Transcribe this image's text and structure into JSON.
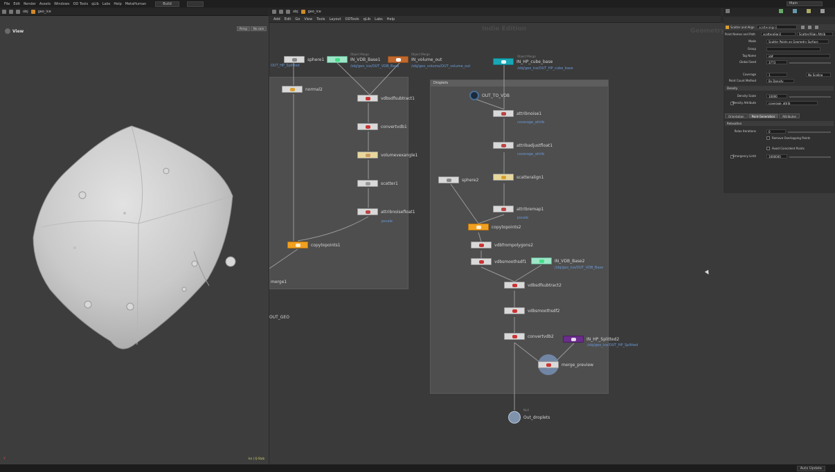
{
  "menubar": {
    "items": [
      "File",
      "Edit",
      "Render",
      "Assets",
      "Windows",
      "OD Tools",
      "qLib",
      "Labs",
      "Help",
      "MetaHuman"
    ],
    "desktop": "Build",
    "main": "Main"
  },
  "left_pane": {
    "path_obj": "obj",
    "path_geo": "geo_ice",
    "view_label": "View",
    "persp_btn": "Persp",
    "cam_btn": "No cam",
    "stats": "Ice | Q-Stab",
    "axis": "y"
  },
  "net_pane": {
    "path_obj": "obj",
    "path_geo": "geo_ice",
    "menu": [
      "Add",
      "Edit",
      "Go",
      "View",
      "Tools",
      "Layout",
      "ODTools",
      "qLib",
      "Labs",
      "Help"
    ],
    "watermark_left": "Indie Edition",
    "watermark_right": "Geometry"
  },
  "nodes": {
    "sphere1": "sphere1",
    "in_vdb_base1": "IN_VDB_Base1",
    "in_vdb_base1_path": "/obj/geo_ice/OUT_VDB_Base",
    "in_volume_out": "IN_volume_out",
    "in_volume_out_path": "/obj/geo_volume/OUT_volume_out",
    "object_merge": "Object Merge",
    "hp_splitted_left": "OUT_HP_Splitted",
    "normal2": "normal2",
    "vdbsdfsubtract1": "vdbsdfsubtract1",
    "convertvdb1": "convertvdb1",
    "volumevexangle1": "volumevexangle1",
    "scatter1": "scatter1",
    "attribnoisefloat1": "attribnoisefloat1",
    "pscale_left": "pscale",
    "copytopoints1": "copytopoints1",
    "merge1": "merge1",
    "out_geo": "OUT_GEO",
    "in_hp_cube_base": "IN_HP_cube_base",
    "in_hp_cube_base_path": "/obj/geo_ice/OUT_HP_cube_base",
    "droplets": "Droplets",
    "out_to_vdb": "OUT_TO_VDB",
    "attribnoise1": "attribnoise1",
    "coverage_attrib1": "coverage_attrib",
    "attribadjustfloat1": "attribadjustfloat1",
    "coverage_attrib2": "coverage_attrib",
    "scatteralign1": "scatteralign1",
    "sphere2": "sphere2",
    "attribremap1": "attribremap1",
    "pscale_right": "pscale",
    "copytopoints2": "copytopoints2",
    "vdbfrompolygons2": "vdbfrompolygons2",
    "vdbsmoothsdf1": "vdbsmoothsdf1",
    "in_vdb_base2": "IN_VDB_Base2",
    "in_vdb_base2_path": "/obj/geo_ice/OUT_VDB_Base",
    "vdbsdfsubtract2": "vdbsdfsubtract2",
    "vdbsmoothsdf2": "vdbsmoothsdf2",
    "convertvdb2": "convertvdb2",
    "in_hp_splitted2": "IN_HP_Splitted2",
    "in_hp_splitted2_path": "/obj/geo_ice/OUT_HP_Splitted",
    "merge_preview": "merge_preview",
    "null_type": "Null",
    "out_droplets": "Out_droplets"
  },
  "params": {
    "header_type": "Scatter and Align",
    "header_name": "scatteralign1",
    "row2_label": "Point Names and Path",
    "row2_val": "scatteralign1",
    "row2_val2": "Scatter/Align Attrib",
    "mode_label": "Mode",
    "mode_val": "Scatter Points on Geometry Surface",
    "group_label": "Group",
    "group_val": "",
    "tag_label": "Tag Name",
    "tag_val": "id#",
    "seed_label": "Global Seed",
    "seed_val": "3773",
    "coverage_label": "Coverage",
    "coverage_val": "1",
    "coverage_mode": "No Scaling",
    "pcm_label": "Point Count Method",
    "pcm_val": "By Density",
    "density_sec": "Density",
    "density_scale_label": "Density Scale",
    "density_scale_val": "10000",
    "density_attr_label": "Density Attribute",
    "density_attr_val": "coverage_attrib",
    "tab_orientation": "Orientation",
    "tab_point_gen": "Point Generation",
    "tab_attributes": "Attributes",
    "relax_sec": "Relaxation",
    "relax_iter_label": "Relax Iterations",
    "relax_iter_val": "0",
    "remove_overlap": "Remove Overlapping Points",
    "avoid_coincident": "Avoid Coincident Points",
    "emergency_label": "Emergency Limit",
    "emergency_val": "1000000"
  },
  "status": {
    "auto_update": "Auto Update"
  },
  "colors": {
    "accent_orange": "#f0a020",
    "teal": "#1aa7b5",
    "link_blue": "#6a9ad8"
  }
}
